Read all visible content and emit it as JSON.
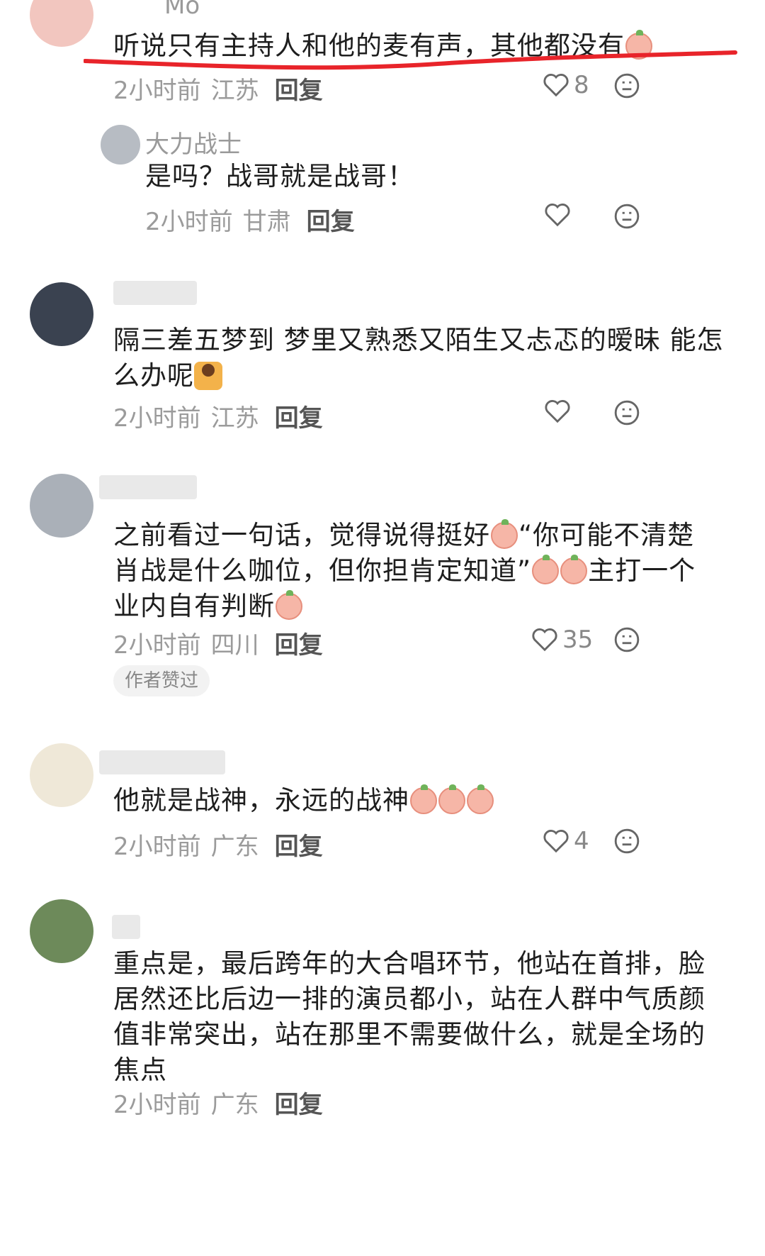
{
  "comments": [
    {
      "username": "Mo",
      "text": "听说只有主持人和他的麦有声，其他都没有",
      "time": "2小时前",
      "location": "江苏",
      "reply_label": "回复",
      "likes": "8"
    },
    {
      "username": "大力战士",
      "text": "是吗？战哥就是战哥！",
      "time": "2小时前",
      "location": "甘肃",
      "reply_label": "回复",
      "likes": ""
    },
    {
      "username": "",
      "text_1": "隔三差五梦到 梦里又熟悉又陌生又忐忑的暧昧 能怎",
      "text_2": "么办呢",
      "time": "2小时前",
      "location": "江苏",
      "reply_label": "回复",
      "likes": ""
    },
    {
      "username": "",
      "text_1": "之前看过一句话，觉得说得挺好",
      "text_1b": "“你可能不清楚",
      "text_2a": "肖战是什么咖位，但你担肯定知道”",
      "text_2b": "主打一个",
      "text_3": "业内自有判断",
      "time": "2小时前",
      "location": "四川",
      "reply_label": "回复",
      "likes": "35",
      "badge": "作者赞过"
    },
    {
      "username": "",
      "text": "他就是战神，永远的战神",
      "time": "2小时前",
      "location": "广东",
      "reply_label": "回复",
      "likes": "4"
    },
    {
      "username": "",
      "lines": [
        "重点是，最后跨年的大合唱环节，他站在首排，脸",
        "居然还比后边一排的演员都小，站在人群中气质颜",
        "值非常突出，站在那里不需要做什么，就是全场的",
        "焦点"
      ],
      "time": "2小时前",
      "location": "广东",
      "reply_label": "回复"
    }
  ],
  "colors": {
    "underline": "#e8242a",
    "muted": "#9b9b9b",
    "badge_bg": "#f2f2f2"
  },
  "icons": {
    "like": "heart-outline-icon",
    "more": "emoji-face-icon"
  }
}
